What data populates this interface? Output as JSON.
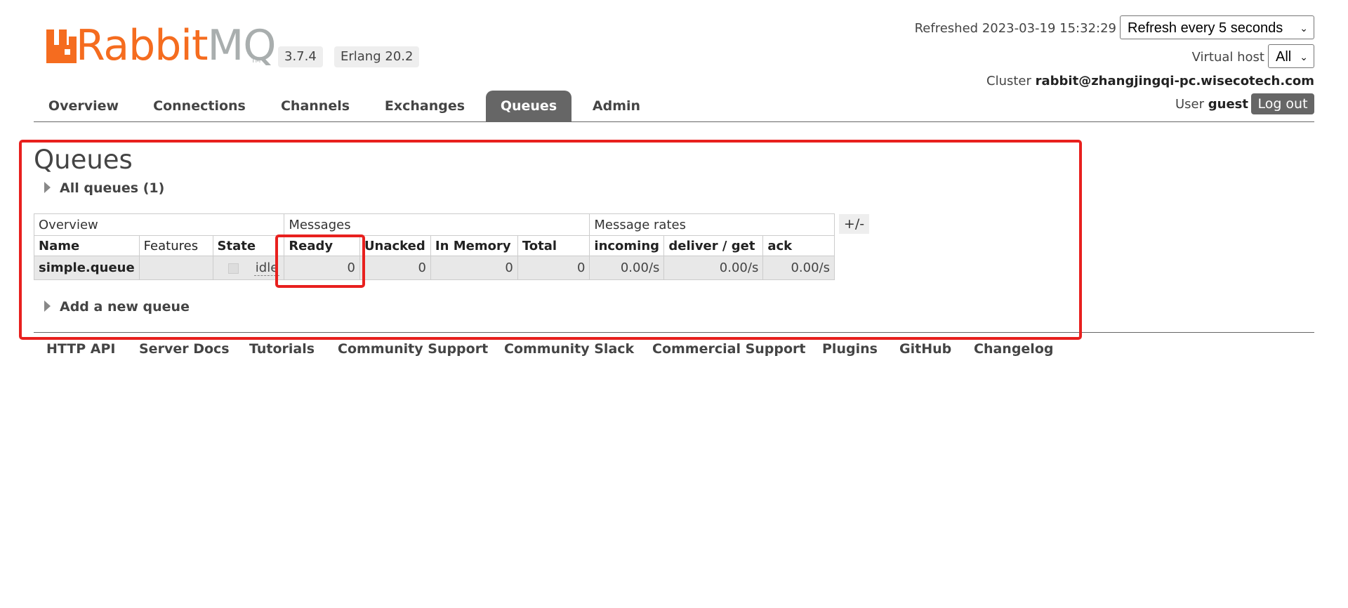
{
  "brand": {
    "word_orange": "Rabbit",
    "word_grey": "MQ",
    "tm": "TM"
  },
  "version": "3.7.4",
  "erlang": "Erlang 20.2",
  "header": {
    "refreshed_label": "Refreshed",
    "refreshed_time": "2023-03-19 15:32:29",
    "refresh_select": "Refresh every 5 seconds",
    "vhost_label": "Virtual host",
    "vhost_select": "All",
    "cluster_label": "Cluster",
    "cluster_name": "rabbit@zhangjingqi-pc.wisecotech.com",
    "user_label": "User",
    "user_name": "guest",
    "logout": "Log out"
  },
  "nav": {
    "items": [
      "Overview",
      "Connections",
      "Channels",
      "Exchanges",
      "Queues",
      "Admin"
    ],
    "active": "Queues"
  },
  "main": {
    "title": "Queues",
    "all_queues": "All queues (1)",
    "add_queue": "Add a new queue",
    "table": {
      "groups": [
        "Overview",
        "Messages",
        "Message rates"
      ],
      "columns": [
        "Name",
        "Features",
        "State",
        "Ready",
        "Unacked",
        "In Memory",
        "Total",
        "incoming",
        "deliver / get",
        "ack"
      ],
      "row": {
        "name": "simple.queue",
        "features": "",
        "state": "idle",
        "ready": "0",
        "unacked": "0",
        "in_memory": "0",
        "total": "0",
        "incoming": "0.00/s",
        "deliver_get": "0.00/s",
        "ack": "0.00/s"
      }
    },
    "plusminus": "+/-"
  },
  "footer": [
    "HTTP API",
    "Server Docs",
    "Tutorials",
    "Community Support",
    "Community Slack",
    "Commercial Support",
    "Plugins",
    "GitHub",
    "Changelog"
  ],
  "colors": {
    "brand_orange": "#f56c1f",
    "brand_grey": "#a9aeae",
    "nav_active": "#666666",
    "highlight": "#e8201e"
  }
}
